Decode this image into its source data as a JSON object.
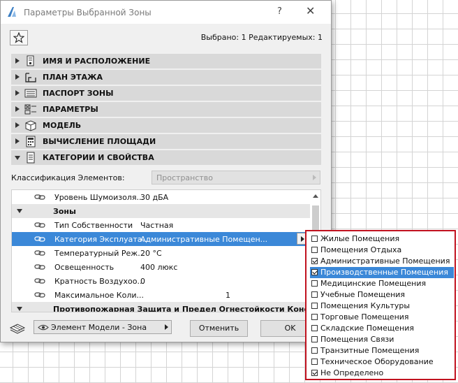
{
  "dialog": {
    "title": "Параметры Выбранной Зоны",
    "help_label": "?",
    "close_label": "✕",
    "selection_info": "Выбрано: 1 Редактируемых: 1"
  },
  "sections": [
    {
      "label": "ИМЯ И РАСПОЛОЖЕНИЕ",
      "icon": "name-location-icon",
      "expanded": false
    },
    {
      "label": "ПЛАН ЭТАЖА",
      "icon": "floor-plan-icon",
      "expanded": false
    },
    {
      "label": "ПАСПОРТ ЗОНЫ",
      "icon": "zone-stamp-icon",
      "expanded": false
    },
    {
      "label": "ПАРАМЕТРЫ",
      "icon": "parameters-icon",
      "expanded": false
    },
    {
      "label": "МОДЕЛЬ",
      "icon": "model-icon",
      "expanded": false
    },
    {
      "label": "ВЫЧИСЛЕНИЕ ПЛОЩАДИ",
      "icon": "area-calculation-icon",
      "expanded": false
    },
    {
      "label": "КАТЕГОРИИ И СВОЙСТВА",
      "icon": "categories-properties-icon",
      "expanded": true
    }
  ],
  "classification": {
    "label": "Классификация Элементов:",
    "value": "Пространство"
  },
  "properties": [
    {
      "type": "row",
      "name": "Уровень Шумоизоля...",
      "value": "30 дБА"
    },
    {
      "type": "group",
      "name": "Зоны"
    },
    {
      "type": "row",
      "name": "Тип Собственности",
      "value": "Частная"
    },
    {
      "type": "row",
      "name": "Категория Эксплуата...",
      "value": "Административные Помещен...",
      "selected": true
    },
    {
      "type": "row",
      "name": "Температурный Реж...",
      "value": "20 °C"
    },
    {
      "type": "row",
      "name": "Освещенность",
      "value": "400 люкс"
    },
    {
      "type": "row",
      "name": "Кратность Воздухоо...",
      "value": "0"
    },
    {
      "type": "row",
      "name": "Максимальное Коли...",
      "value": "1"
    },
    {
      "type": "group",
      "name": "Противопожарная Защита и Предел Огнестойкости Констук"
    }
  ],
  "footer": {
    "model_dropdown": "Элемент Модели - Зона",
    "cancel_label": "Отменить",
    "ok_label": "OK"
  },
  "popup_items": [
    {
      "label": "Жилые Помещения",
      "checked": false
    },
    {
      "label": "Помещения Отдыха",
      "checked": false
    },
    {
      "label": "Административные Помещения",
      "checked": true
    },
    {
      "label": "Производственные Помещения",
      "checked": true,
      "highlighted": true
    },
    {
      "label": "Медицинские Помещения",
      "checked": false
    },
    {
      "label": "Учебные Помещения",
      "checked": false
    },
    {
      "label": "Помещения Культуры",
      "checked": false
    },
    {
      "label": "Торговые Помещения",
      "checked": false
    },
    {
      "label": "Складские Помещения",
      "checked": false
    },
    {
      "label": "Помещения Связи",
      "checked": false
    },
    {
      "label": "Транзитные Помещения",
      "checked": false
    },
    {
      "label": "Техническое Оборудование",
      "checked": false
    },
    {
      "label": "Не Определено",
      "checked": true
    }
  ],
  "colors": {
    "selection_blue": "#3b88d8",
    "popup_border": "#c1121f",
    "section_gray": "#d9d9d9"
  }
}
